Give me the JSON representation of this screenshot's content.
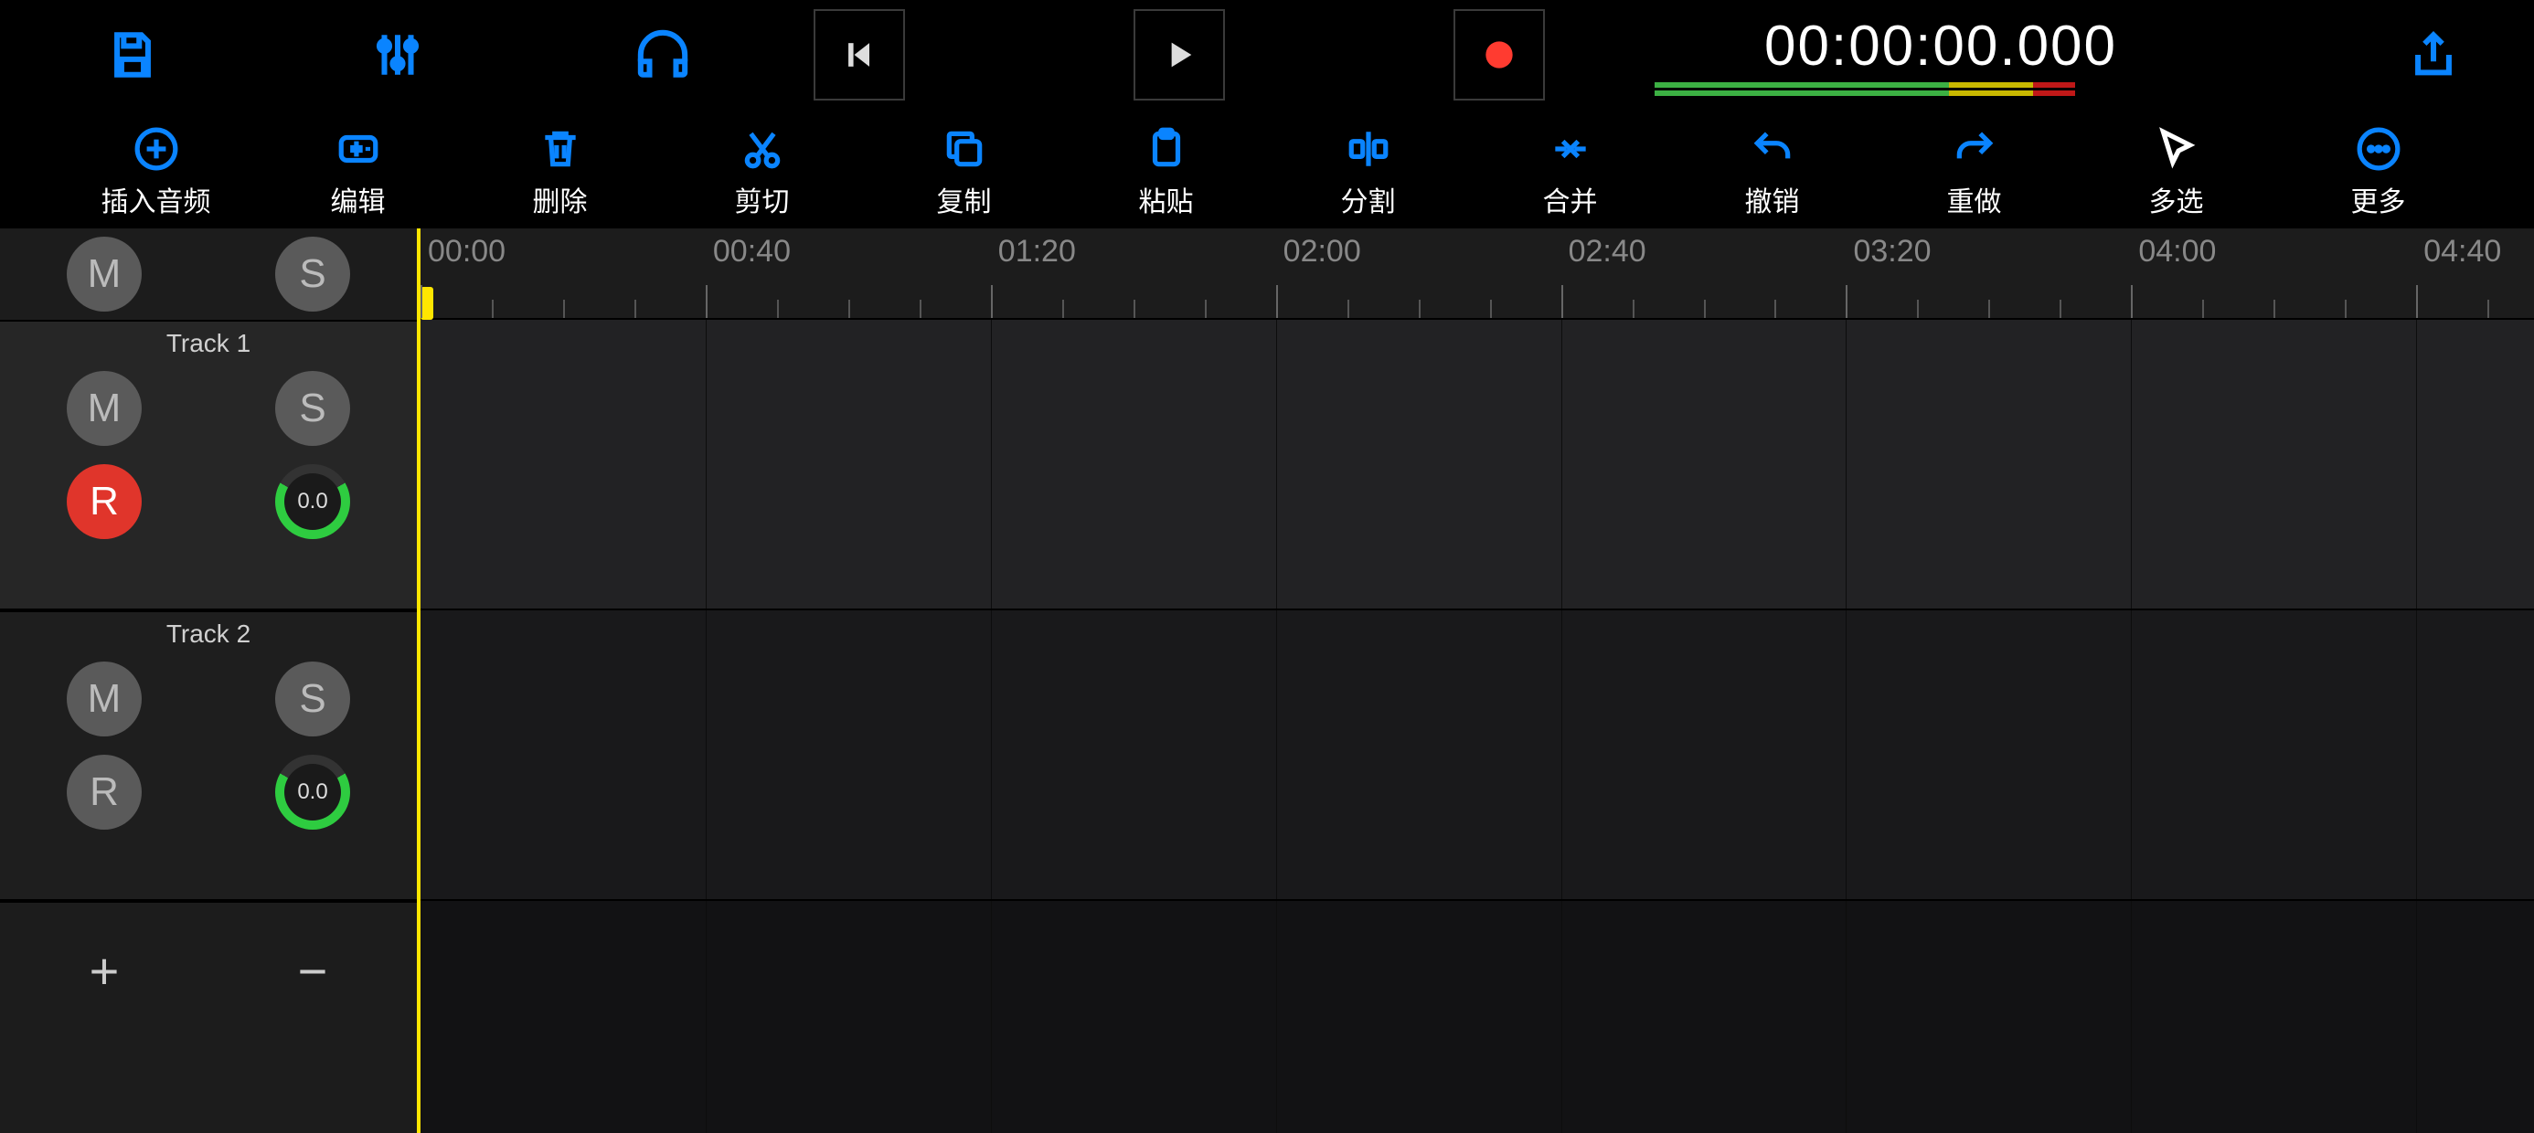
{
  "timecode": "00:00:00.000",
  "toolbar": {
    "insert_audio": "插入音频",
    "edit": "编辑",
    "delete": "删除",
    "cut": "剪切",
    "copy": "复制",
    "paste": "粘贴",
    "split": "分割",
    "merge": "合并",
    "undo": "撤销",
    "redo": "重做",
    "multi_select": "多选",
    "more": "更多"
  },
  "ruler_header": {
    "mute": "M",
    "solo": "S"
  },
  "tracks": [
    {
      "name": "Track 1",
      "mute": "M",
      "solo": "S",
      "record": "R",
      "record_armed": true,
      "level": "0.0"
    },
    {
      "name": "Track 2",
      "mute": "M",
      "solo": "S",
      "record": "R",
      "record_armed": false,
      "level": "0.0"
    }
  ],
  "add_label": "+",
  "remove_label": "−",
  "ruler_ticks": [
    "00:00",
    "00:40",
    "01:20",
    "02:00",
    "02:40",
    "03:20",
    "04:00",
    "04:40"
  ]
}
